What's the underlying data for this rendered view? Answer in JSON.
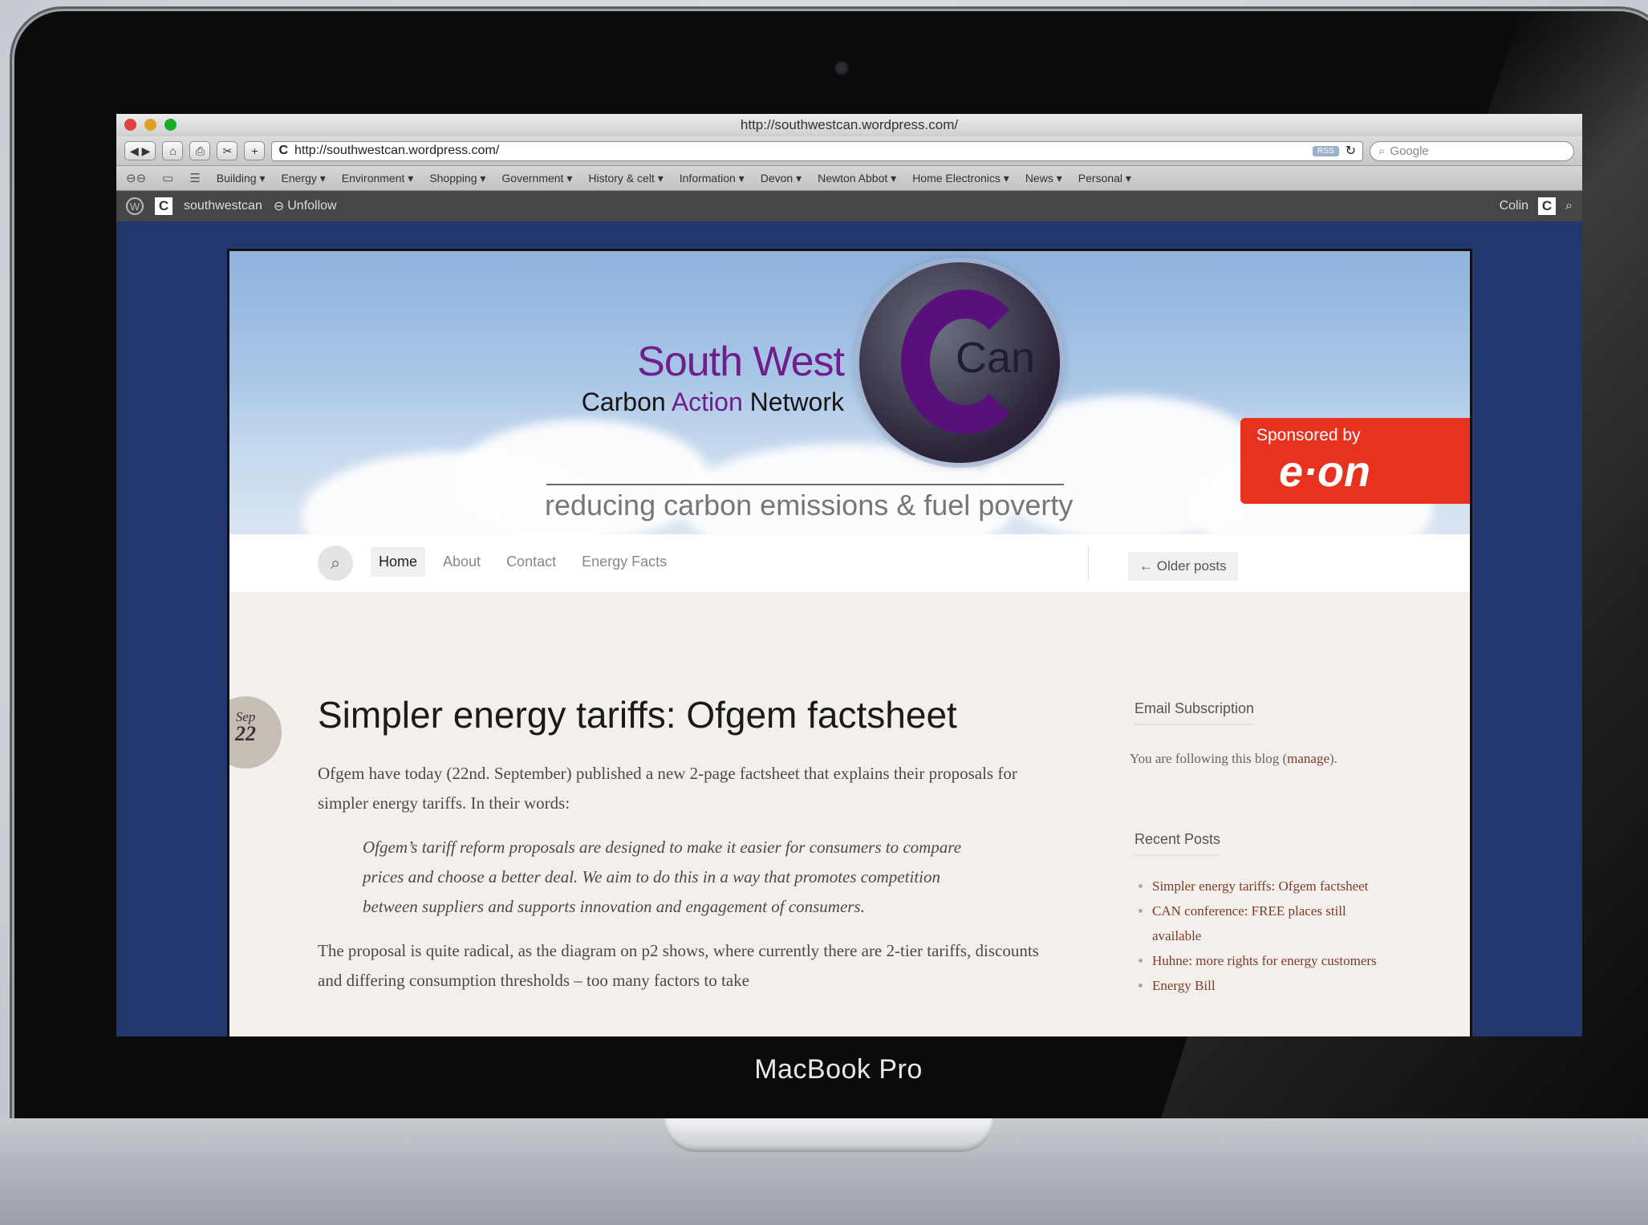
{
  "device": {
    "brand_label": "MacBook Pro"
  },
  "browser": {
    "window_title": "http://southwestcan.wordpress.com/",
    "url": "http://southwestcan.wordpress.com/",
    "rss_label": "RSS",
    "search_placeholder": "Google",
    "bookmarks": [
      "Building ▾",
      "Energy ▾",
      "Environment ▾",
      "Shopping ▾",
      "Government ▾",
      "History & celt ▾",
      "Information ▾",
      "Devon ▾",
      "Newton Abbot ▾",
      "Home Electronics ▾",
      "News ▾",
      "Personal ▾"
    ]
  },
  "wpbar": {
    "site_name": "southwestcan",
    "unfollow_label": "Unfollow",
    "user_name": "Colin"
  },
  "site": {
    "title_main": "South West",
    "title_sub_1": "Carbon",
    "title_sub_2": "Action",
    "title_sub_3": "Network",
    "logo_text": "Can",
    "tagline": "reducing carbon emissions & fuel poverty",
    "sponsor_label": "Sponsored by",
    "sponsor_brand": "e·on",
    "nav": [
      "Home",
      "About",
      "Contact",
      "Energy Facts"
    ],
    "older_posts": "← Older posts"
  },
  "post": {
    "date_month": "Sep",
    "date_day": "22",
    "title": "Simpler energy tariffs: Ofgem factsheet",
    "para1": "Ofgem have today (22nd. September) published a new 2-page factsheet that explains their proposals for simpler energy tariffs. In their words:",
    "quote": "Ofgem’s tariff reform proposals are designed to make it easier for consumers to compare prices and choose a better deal. We aim to do this in a way that promotes competition between suppliers and supports innovation and engagement of consumers.",
    "para2": "The proposal is quite radical, as the diagram on p2 shows, where currently there are 2-tier tariffs, discounts and differing consumption thresholds – too many factors to take"
  },
  "sidebar": {
    "email_title": "Email Subscription",
    "email_text_pre": "You are following this blog (",
    "email_manage": "manage",
    "email_text_post": ").",
    "recent_title": "Recent Posts",
    "recent_posts": [
      "Simpler energy tariffs: Ofgem factsheet",
      "CAN conference: FREE places still available",
      "Huhne: more rights for energy customers",
      "Energy Bill"
    ]
  }
}
